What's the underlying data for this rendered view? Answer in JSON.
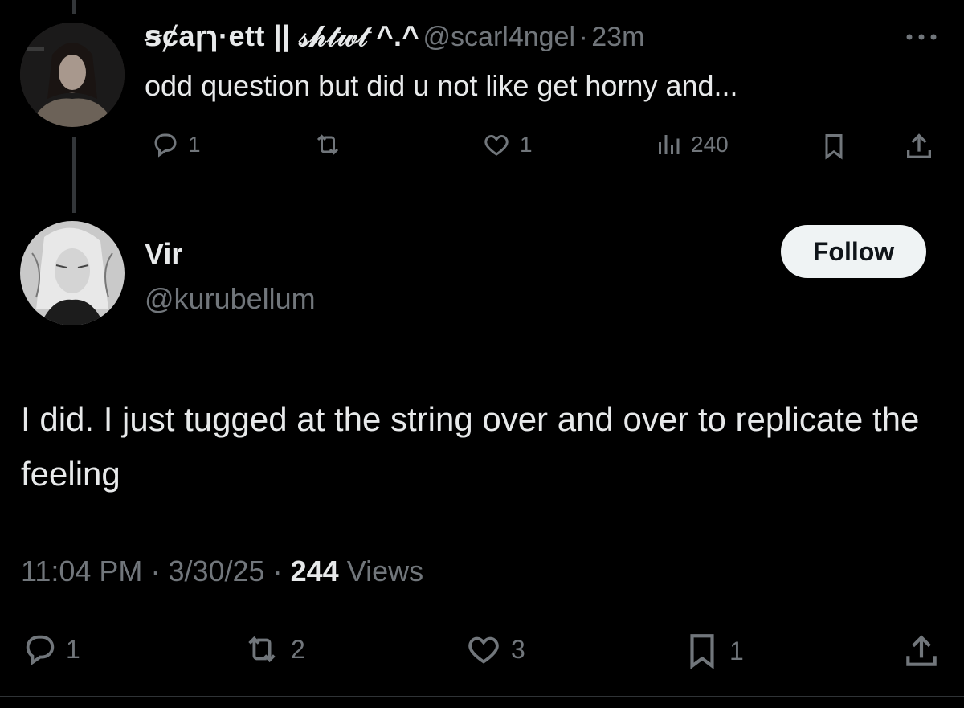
{
  "parent_tweet": {
    "display_name": "ꞩȼaɼɿ·ett || 𝓈𝒽𝓉𝓌𝓉 ^.^",
    "handle": "@scarl4ngel",
    "separator": "·",
    "time_ago": "23m",
    "text": "odd question but did u not like get horny and...",
    "replies": "1",
    "retweets": "",
    "likes": "1",
    "views": "240"
  },
  "main_tweet": {
    "display_name": "Vir",
    "handle": "@kurubellum",
    "follow_label": "Follow",
    "text": "I did. I just tugged at the string over and over to replicate the feeling",
    "time": "11:04 PM",
    "date": "3/30/25",
    "views_count": "244",
    "views_label": "Views",
    "replies": "1",
    "retweets": "2",
    "likes": "3",
    "bookmarks": "1"
  },
  "icons": [
    "more-icon",
    "reply-icon",
    "retweet-icon",
    "like-icon",
    "views-icon",
    "bookmark-icon",
    "share-icon"
  ],
  "colors": {
    "background": "#000000",
    "text": "#e7e9ea",
    "muted": "#71767b",
    "follow_bg": "#eff3f4"
  }
}
